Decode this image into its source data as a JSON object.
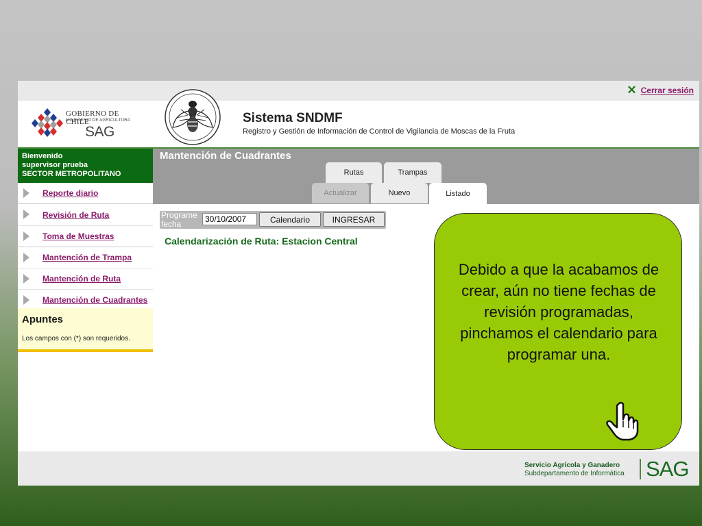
{
  "topbar": {
    "logout_label": "Cerrar sesión"
  },
  "header": {
    "gob_line1": "GOBIERNO DE CHILE",
    "gob_line2": "MINISTERIO DE AGRICULTURA",
    "gob_line3": "SAG",
    "system_title": "Sistema SNDMF",
    "system_subtitle": "Registro y Gestión de Información de Control de Vigilancia de Moscas de la Fruta"
  },
  "sidebar": {
    "welcome_line1": "Bienvenido",
    "welcome_line2": "supervisor prueba",
    "welcome_line3": "SECTOR METROPOLITANO",
    "items": [
      {
        "label": "Reporte diario"
      },
      {
        "label": "Revisión de Ruta"
      },
      {
        "label": "Toma de Muestras"
      },
      {
        "label": "Mantención de Trampa"
      },
      {
        "label": "Mantención de Ruta"
      },
      {
        "label": "Mantención de Cuadrantes"
      }
    ],
    "apuntes_title": "Apuntes",
    "apuntes_note": "Los campos con (*) son requeridos."
  },
  "main": {
    "title": "Mantención de Cuadrantes",
    "tabs_top": [
      {
        "label": "Rutas"
      },
      {
        "label": "Trampas"
      }
    ],
    "tabs_bottom": [
      {
        "label": "Actualizar"
      },
      {
        "label": "Nuevo"
      },
      {
        "label": "Listado"
      }
    ],
    "form": {
      "label_line1": "Programe",
      "label_line2": "fecha",
      "date_value": "30/10/2007",
      "calendar_button": "Calendario",
      "ingresar_button": "INGRESAR"
    },
    "route_title": "Calendarización de Ruta: Estacion Central"
  },
  "callout": {
    "text": "Debido a que la acabamos de crear, aún no tiene fechas de revisión programadas, pinchamos el calendario para programar una."
  },
  "footer": {
    "line1": "Servicio Agrícola y Ganadero",
    "line2": "Subdepartamento de Informática",
    "logo_text": "SAG"
  },
  "colors": {
    "sidebar_green": "#0c6a12",
    "link_purple": "#8a1c6a",
    "callout_green": "#98cb06",
    "route_title_green": "#176a1c"
  },
  "icons": [
    "close-icon",
    "fly-logo-icon",
    "gob-chile-logo-icon",
    "chevron-right-icon",
    "hand-pointer-icon"
  ]
}
